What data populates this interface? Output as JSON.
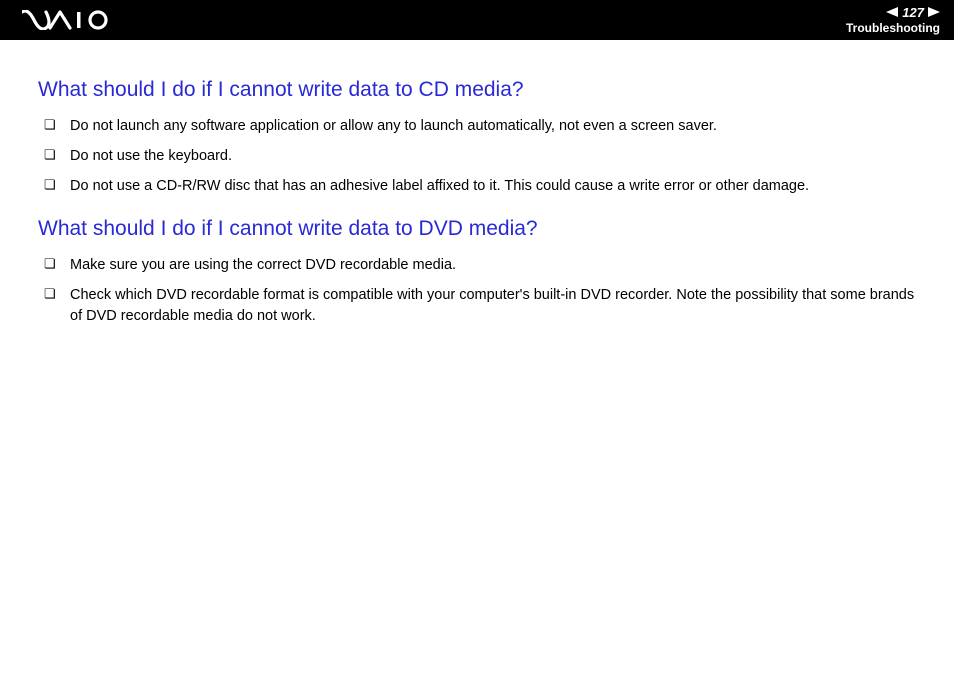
{
  "header": {
    "page_number": "127",
    "section_label": "Troubleshooting"
  },
  "sections": [
    {
      "heading": "What should I do if I cannot write data to CD media?",
      "items": [
        "Do not launch any software application or allow any to launch automatically, not even a screen saver.",
        "Do not use the keyboard.",
        "Do not use a CD-R/RW disc that has an adhesive label affixed to it. This could cause a write error or other damage."
      ]
    },
    {
      "heading": "What should I do if I cannot write data to DVD media?",
      "items": [
        "Make sure you are using the correct DVD recordable media.",
        "Check which DVD recordable format is compatible with your computer's built-in DVD recorder. Note the possibility that some brands of DVD recordable media do not work."
      ]
    }
  ]
}
